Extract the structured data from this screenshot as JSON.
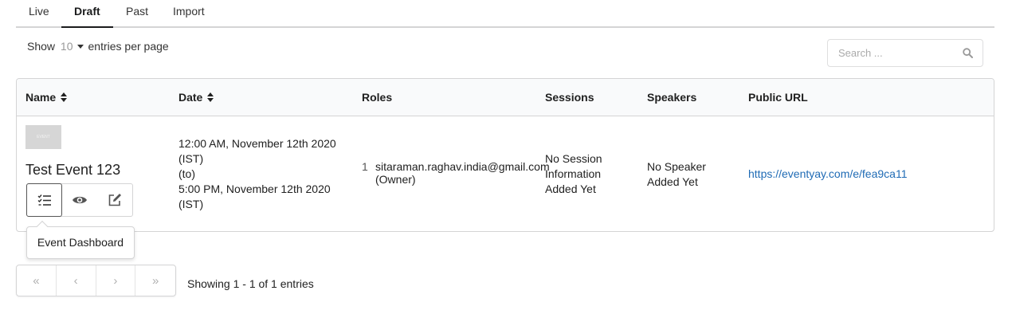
{
  "tabs": [
    {
      "label": "Live",
      "active": false
    },
    {
      "label": "Draft",
      "active": true
    },
    {
      "label": "Past",
      "active": false
    },
    {
      "label": "Import",
      "active": false
    }
  ],
  "entries": {
    "prefix": "Show",
    "count": "10",
    "suffix": "entries per page"
  },
  "search": {
    "placeholder": "Search ...",
    "value": ""
  },
  "table": {
    "headers": {
      "name": "Name",
      "date": "Date",
      "roles": "Roles",
      "sessions": "Sessions",
      "speakers": "Speakers",
      "public_url": "Public URL"
    },
    "row": {
      "thumbnail_text": "EVENT",
      "name": "Test Event 123",
      "date_lines": [
        "12:00 AM, November 12th 2020",
        "(IST)",
        "(to)",
        "5:00 PM, November 12th 2020",
        "(IST)"
      ],
      "role_index": "1",
      "role_email": "sitaraman.raghav.india@gmail.com",
      "role_label": "(Owner)",
      "sessions_lines": [
        "No Session",
        "Information",
        "Added Yet"
      ],
      "speakers_lines": [
        "No Speaker",
        "Added Yet"
      ],
      "public_url": "https://eventyay.com/e/fea9ca11"
    }
  },
  "tooltip": {
    "text": "Event Dashboard"
  },
  "pagination": {
    "first": "«",
    "prev": "‹",
    "next": "›",
    "last": "»",
    "summary": "Showing 1 - 1 of 1 entries"
  },
  "colors": {
    "link": "#1f6bb5",
    "border": "#d4d4d5",
    "header_bg": "#f9fafb"
  }
}
